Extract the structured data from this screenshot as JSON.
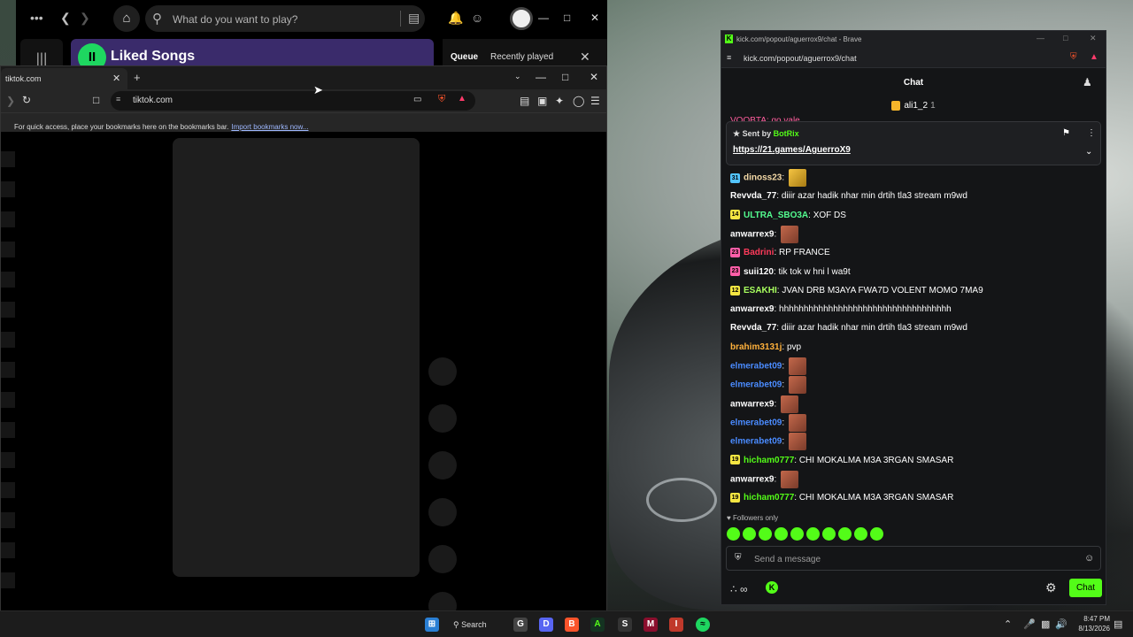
{
  "spotify": {
    "search_placeholder": "What do you want to play?",
    "liked_title": "Liked Songs",
    "queue_label": "Queue",
    "recent_label": "Recently played"
  },
  "tiktok": {
    "tab_title": "tiktok.com",
    "url": "tiktok.com",
    "bookmarks_msg": "For quick access, place your bookmarks here on the bookmarks bar.",
    "bookmarks_link": "Import bookmarks now..."
  },
  "kick": {
    "window_title": "kick.com/popout/aguerrox9/chat - Brave",
    "url": "kick.com/popout/aguerrox9/chat",
    "header": "Chat",
    "top_user": "ali1_2",
    "top_user_count": "1",
    "partial_msg": "VOOBTA: go vale",
    "pinned": {
      "sent_by": "Sent by",
      "bot_name": "BotRix",
      "link": "https://21.games/AguerroX9"
    },
    "messages": [
      {
        "badge": "31",
        "badge_color": "#53c4ff",
        "user": "dinoss23",
        "user_color": "#f4d9a6",
        "text": "",
        "emotes": [
          "gold"
        ]
      },
      {
        "badge": "",
        "badge_color": "",
        "user": "Revvda_77",
        "user_color": "#ffffff",
        "text": "diiir azar hadik nhar min drtih tla3 stream m9wd",
        "emotes": []
      },
      {
        "badge": "14",
        "badge_color": "#f5e642",
        "user": "ULTRA_SBO3A",
        "user_color": "#53fc8f",
        "text": "XOF DS",
        "emotes": []
      },
      {
        "badge": "",
        "badge_color": "",
        "user": "anwarrex9",
        "user_color": "#ffffff",
        "text": "",
        "emotes": [
          "face"
        ]
      },
      {
        "badge": "23",
        "badge_color": "#ff5ea8",
        "user": "Badrini",
        "user_color": "#ff3b5b",
        "text": "RP FRANCE",
        "emotes": []
      },
      {
        "badge": "23",
        "badge_color": "#ff5ea8",
        "user": "suii120",
        "user_color": "#ffffff",
        "text": "tik tok w hni l wa9t",
        "emotes": []
      },
      {
        "badge": "12",
        "badge_color": "#f5e642",
        "user": "ESAKHI",
        "user_color": "#a8ff5e",
        "text": "JVAN DRB M3AYA FWA7D VOLENT MOMO 7MA9",
        "emotes": []
      },
      {
        "badge": "",
        "badge_color": "",
        "user": "anwarrex9",
        "user_color": "#ffffff",
        "text": "hhhhhhhhhhhhhhhhhhhhhhhhhhhhhhhhhhh",
        "emotes": []
      },
      {
        "badge": "",
        "badge_color": "",
        "user": "Revvda_77",
        "user_color": "#ffffff",
        "text": "diiir azar hadik nhar min drtih tla3 stream m9wd",
        "emotes": []
      },
      {
        "badge": "",
        "badge_color": "",
        "user": "brahim3131j",
        "user_color": "#ffb13b",
        "text": "pvp",
        "emotes": []
      },
      {
        "badge": "",
        "badge_color": "",
        "user": "elmerabet09",
        "user_color": "#4a8bff",
        "text": "",
        "emotes": [
          "face"
        ]
      },
      {
        "badge": "",
        "badge_color": "",
        "user": "elmerabet09",
        "user_color": "#4a8bff",
        "text": "",
        "emotes": [
          "face"
        ]
      },
      {
        "badge": "",
        "badge_color": "",
        "user": "anwarrex9",
        "user_color": "#ffffff",
        "text": "",
        "emotes": [
          "face"
        ]
      },
      {
        "badge": "",
        "badge_color": "",
        "user": "elmerabet09",
        "user_color": "#4a8bff",
        "text": "",
        "emotes": [
          "face"
        ]
      },
      {
        "badge": "",
        "badge_color": "",
        "user": "elmerabet09",
        "user_color": "#4a8bff",
        "text": "",
        "emotes": [
          "face"
        ]
      },
      {
        "badge": "19",
        "badge_color": "#f5e642",
        "user": "hicham0777",
        "user_color": "#53fc18",
        "text": "CHI MOKALMA M3A 3RGAN SMASAR",
        "emotes": []
      },
      {
        "badge": "",
        "badge_color": "",
        "user": "anwarrex9",
        "user_color": "#ffffff",
        "text": "",
        "emotes": [
          "face"
        ]
      },
      {
        "badge": "19",
        "badge_color": "#f5e642",
        "user": "hicham0777",
        "user_color": "#53fc18",
        "text": "CHI MOKALMA M3A 3RGAN SMASAR",
        "emotes": []
      }
    ],
    "followers_only": "Followers only",
    "input_placeholder": "Send a message",
    "chat_button": "Chat",
    "accent": "#53fc18"
  },
  "taskbar": {
    "search": "Search",
    "time": "8:47 PM",
    "date": "8/13/2026"
  }
}
